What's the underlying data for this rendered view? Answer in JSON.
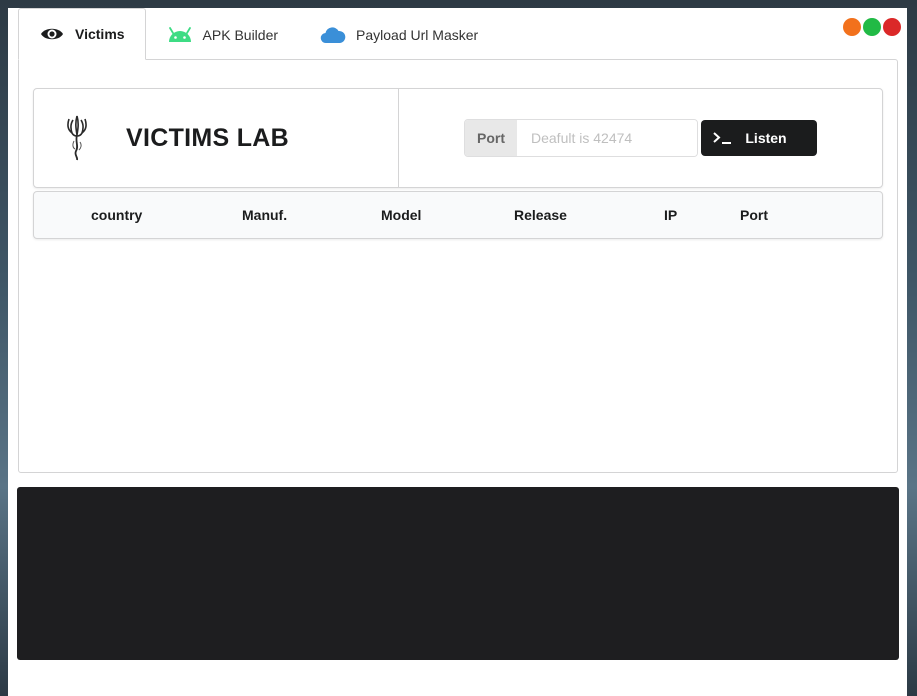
{
  "tabs": [
    {
      "label": "Victims",
      "icon": "eye-icon",
      "active": true
    },
    {
      "label": "APK Builder",
      "icon": "android-icon",
      "active": false
    },
    {
      "label": "Payload Url Masker",
      "icon": "cloud-icon",
      "active": false
    }
  ],
  "window_controls": {
    "minimize_color": "#f2711c",
    "maximize_color": "#21ba45",
    "close_color": "#db2828"
  },
  "lab": {
    "title": "VICTIMS LAB",
    "port_label": "Port",
    "port_placeholder": "Deafult is 42474",
    "port_value": "",
    "listen_label": "Listen"
  },
  "table": {
    "columns": [
      "country",
      "Manuf.",
      "Model",
      "Release",
      "IP",
      "Port"
    ],
    "rows": []
  },
  "console": {
    "lines": []
  }
}
